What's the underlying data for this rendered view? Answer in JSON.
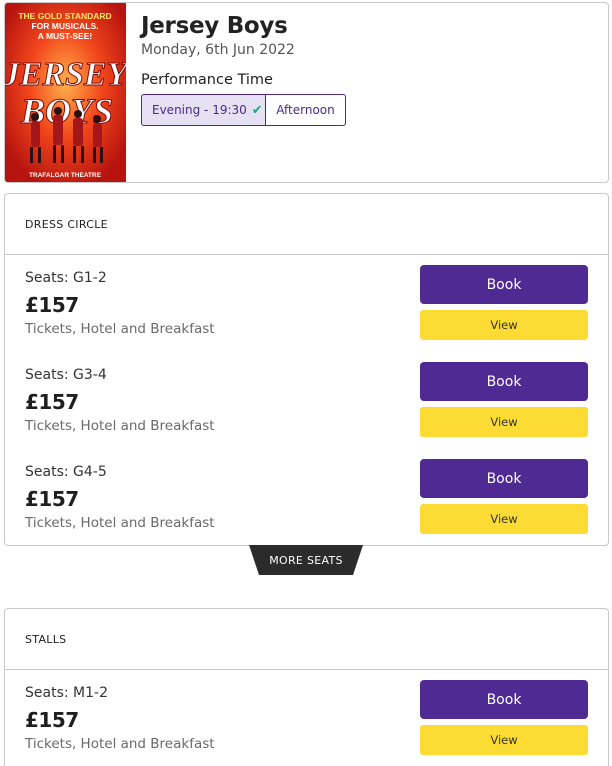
{
  "show": {
    "title": "Jersey Boys",
    "date": "Monday, 6th Jun 2022",
    "performance_label": "Performance Time",
    "times": [
      {
        "label": "Evening - 19:30",
        "selected": true
      },
      {
        "label": "Afternoon",
        "selected": false
      }
    ],
    "poster": {
      "tagline_1": "THE GOLD STANDARD",
      "tagline_2": "FOR MUSICALS.",
      "tagline_3": "A MUST-SEE!",
      "word_1": "JERSEY",
      "word_2": "BOYS",
      "venue": "TRAFALGAR THEATRE"
    }
  },
  "sections": [
    {
      "name": "DRESS CIRCLE",
      "seats": [
        {
          "seats": "Seats: G1-2",
          "price": "£157",
          "package": "Tickets, Hotel and Breakfast",
          "book": "Book",
          "view": "View"
        },
        {
          "seats": "Seats: G3-4",
          "price": "£157",
          "package": "Tickets, Hotel and Breakfast",
          "book": "Book",
          "view": "View"
        },
        {
          "seats": "Seats: G4-5",
          "price": "£157",
          "package": "Tickets, Hotel and Breakfast",
          "book": "Book",
          "view": "View"
        }
      ]
    },
    {
      "name": "STALLS",
      "seats": [
        {
          "seats": "Seats: M1-2",
          "price": "£157",
          "package": "Tickets, Hotel and Breakfast",
          "book": "Book",
          "view": "View"
        }
      ]
    }
  ],
  "more_seats_label": "MORE SEATS",
  "colors": {
    "primary": "#4f2a92",
    "accent_yellow": "#fddb35",
    "selected_bg": "#e5e1f2",
    "check": "#1aa68a"
  }
}
